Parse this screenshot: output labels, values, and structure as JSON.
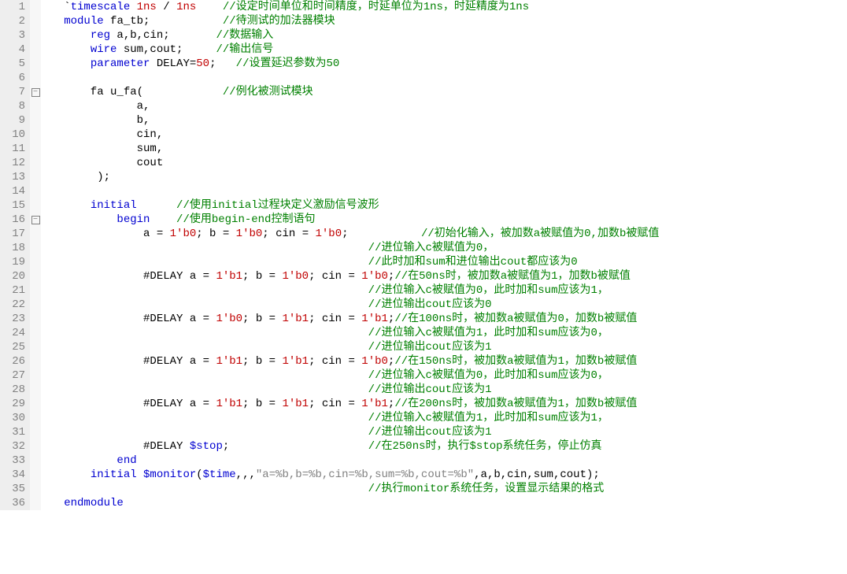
{
  "line_count": 36,
  "fold_markers": {
    "7": "⊟",
    "16": "⊟"
  },
  "lines": [
    {
      "n": 1,
      "segs": [
        {
          "t": "   `",
          "c": "tok-id"
        },
        {
          "t": "timescale ",
          "c": "tok-kw"
        },
        {
          "t": "1ns",
          "c": "tok-num"
        },
        {
          "t": " / ",
          "c": "tok-id"
        },
        {
          "t": "1ns",
          "c": "tok-num"
        },
        {
          "t": "    ",
          "c": "tok-id"
        },
        {
          "t": "//设定时间单位和时间精度，时延单位为1ns，时延精度为1ns",
          "c": "tok-cmt"
        }
      ]
    },
    {
      "n": 2,
      "segs": [
        {
          "t": "   ",
          "c": "tok-id"
        },
        {
          "t": "module",
          "c": "tok-kw"
        },
        {
          "t": " fa_tb;           ",
          "c": "tok-id"
        },
        {
          "t": "//待测试的加法器模块",
          "c": "tok-cmt"
        }
      ]
    },
    {
      "n": 3,
      "segs": [
        {
          "t": "       ",
          "c": "tok-id"
        },
        {
          "t": "reg",
          "c": "tok-kw"
        },
        {
          "t": " a,b,cin;       ",
          "c": "tok-id"
        },
        {
          "t": "//数据输入",
          "c": "tok-cmt"
        }
      ]
    },
    {
      "n": 4,
      "segs": [
        {
          "t": "       ",
          "c": "tok-id"
        },
        {
          "t": "wire",
          "c": "tok-kw"
        },
        {
          "t": " sum,cout;     ",
          "c": "tok-id"
        },
        {
          "t": "//输出信号",
          "c": "tok-cmt"
        }
      ]
    },
    {
      "n": 5,
      "segs": [
        {
          "t": "       ",
          "c": "tok-id"
        },
        {
          "t": "parameter",
          "c": "tok-kw"
        },
        {
          "t": " DELAY=",
          "c": "tok-id"
        },
        {
          "t": "50",
          "c": "tok-num"
        },
        {
          "t": ";   ",
          "c": "tok-id"
        },
        {
          "t": "//设置延迟参数为50",
          "c": "tok-cmt"
        }
      ]
    },
    {
      "n": 6,
      "segs": [
        {
          "t": "",
          "c": "tok-id"
        }
      ]
    },
    {
      "n": 7,
      "segs": [
        {
          "t": "       fa u_fa(            ",
          "c": "tok-id"
        },
        {
          "t": "//例化被测试模块",
          "c": "tok-cmt"
        }
      ]
    },
    {
      "n": 8,
      "segs": [
        {
          "t": "              a,",
          "c": "tok-id"
        }
      ]
    },
    {
      "n": 9,
      "segs": [
        {
          "t": "              b,",
          "c": "tok-id"
        }
      ]
    },
    {
      "n": 10,
      "segs": [
        {
          "t": "              cin,",
          "c": "tok-id"
        }
      ]
    },
    {
      "n": 11,
      "segs": [
        {
          "t": "              sum,",
          "c": "tok-id"
        }
      ]
    },
    {
      "n": 12,
      "segs": [
        {
          "t": "              cout",
          "c": "tok-id"
        }
      ]
    },
    {
      "n": 13,
      "segs": [
        {
          "t": "        );",
          "c": "tok-id"
        }
      ]
    },
    {
      "n": 14,
      "segs": [
        {
          "t": "",
          "c": "tok-id"
        }
      ]
    },
    {
      "n": 15,
      "segs": [
        {
          "t": "       ",
          "c": "tok-id"
        },
        {
          "t": "initial",
          "c": "tok-kw"
        },
        {
          "t": "      ",
          "c": "tok-id"
        },
        {
          "t": "//使用initial过程块定义激励信号波形",
          "c": "tok-cmt"
        }
      ]
    },
    {
      "n": 16,
      "segs": [
        {
          "t": "           ",
          "c": "tok-id"
        },
        {
          "t": "begin",
          "c": "tok-kw"
        },
        {
          "t": "    ",
          "c": "tok-id"
        },
        {
          "t": "//使用begin-end控制语句",
          "c": "tok-cmt"
        }
      ]
    },
    {
      "n": 17,
      "segs": [
        {
          "t": "               a = ",
          "c": "tok-id"
        },
        {
          "t": "1'b0",
          "c": "tok-num"
        },
        {
          "t": "; b = ",
          "c": "tok-id"
        },
        {
          "t": "1'b0",
          "c": "tok-num"
        },
        {
          "t": "; cin = ",
          "c": "tok-id"
        },
        {
          "t": "1'b0",
          "c": "tok-num"
        },
        {
          "t": ";           ",
          "c": "tok-id"
        },
        {
          "t": "//初始化输入，被加数a被赋值为0,加数b被赋值",
          "c": "tok-cmt"
        }
      ]
    },
    {
      "n": 18,
      "segs": [
        {
          "t": "                                                 ",
          "c": "tok-id"
        },
        {
          "t": "//进位输入c被赋值为0，",
          "c": "tok-cmt"
        }
      ]
    },
    {
      "n": 19,
      "segs": [
        {
          "t": "                                                 ",
          "c": "tok-id"
        },
        {
          "t": "//此时加和sum和进位输出cout都应该为0",
          "c": "tok-cmt"
        }
      ]
    },
    {
      "n": 20,
      "segs": [
        {
          "t": "               #DELAY a = ",
          "c": "tok-id"
        },
        {
          "t": "1'b1",
          "c": "tok-num"
        },
        {
          "t": "; b = ",
          "c": "tok-id"
        },
        {
          "t": "1'b0",
          "c": "tok-num"
        },
        {
          "t": "; cin = ",
          "c": "tok-id"
        },
        {
          "t": "1'b0",
          "c": "tok-num"
        },
        {
          "t": ";",
          "c": "tok-id"
        },
        {
          "t": "//在50ns时，被加数a被赋值为1，加数b被赋值",
          "c": "tok-cmt"
        }
      ]
    },
    {
      "n": 21,
      "segs": [
        {
          "t": "                                                 ",
          "c": "tok-id"
        },
        {
          "t": "//进位输入c被赋值为0，此时加和sum应该为1，",
          "c": "tok-cmt"
        }
      ]
    },
    {
      "n": 22,
      "segs": [
        {
          "t": "                                                 ",
          "c": "tok-id"
        },
        {
          "t": "//进位输出cout应该为0",
          "c": "tok-cmt"
        }
      ]
    },
    {
      "n": 23,
      "segs": [
        {
          "t": "               #DELAY a = ",
          "c": "tok-id"
        },
        {
          "t": "1'b0",
          "c": "tok-num"
        },
        {
          "t": "; b = ",
          "c": "tok-id"
        },
        {
          "t": "1'b1",
          "c": "tok-num"
        },
        {
          "t": "; cin = ",
          "c": "tok-id"
        },
        {
          "t": "1'b1",
          "c": "tok-num"
        },
        {
          "t": ";",
          "c": "tok-id"
        },
        {
          "t": "//在100ns时，被加数a被赋值为0，加数b被赋值",
          "c": "tok-cmt"
        }
      ]
    },
    {
      "n": 24,
      "segs": [
        {
          "t": "                                                 ",
          "c": "tok-id"
        },
        {
          "t": "//进位输入c被赋值为1，此时加和sum应该为0，",
          "c": "tok-cmt"
        }
      ]
    },
    {
      "n": 25,
      "segs": [
        {
          "t": "                                                 ",
          "c": "tok-id"
        },
        {
          "t": "//进位输出cout应该为1",
          "c": "tok-cmt"
        }
      ]
    },
    {
      "n": 26,
      "segs": [
        {
          "t": "               #DELAY a = ",
          "c": "tok-id"
        },
        {
          "t": "1'b1",
          "c": "tok-num"
        },
        {
          "t": "; b = ",
          "c": "tok-id"
        },
        {
          "t": "1'b1",
          "c": "tok-num"
        },
        {
          "t": "; cin = ",
          "c": "tok-id"
        },
        {
          "t": "1'b0",
          "c": "tok-num"
        },
        {
          "t": ";",
          "c": "tok-id"
        },
        {
          "t": "//在150ns时，被加数a被赋值为1，加数b被赋值",
          "c": "tok-cmt"
        }
      ]
    },
    {
      "n": 27,
      "segs": [
        {
          "t": "                                                 ",
          "c": "tok-id"
        },
        {
          "t": "//进位输入c被赋值为0，此时加和sum应该为0，",
          "c": "tok-cmt"
        }
      ]
    },
    {
      "n": 28,
      "segs": [
        {
          "t": "                                                 ",
          "c": "tok-id"
        },
        {
          "t": "//进位输出cout应该为1",
          "c": "tok-cmt"
        }
      ]
    },
    {
      "n": 29,
      "segs": [
        {
          "t": "               #DELAY a = ",
          "c": "tok-id"
        },
        {
          "t": "1'b1",
          "c": "tok-num"
        },
        {
          "t": "; b = ",
          "c": "tok-id"
        },
        {
          "t": "1'b1",
          "c": "tok-num"
        },
        {
          "t": "; cin = ",
          "c": "tok-id"
        },
        {
          "t": "1'b1",
          "c": "tok-num"
        },
        {
          "t": ";",
          "c": "tok-id"
        },
        {
          "t": "//在200ns时，被加数a被赋值为1，加数b被赋值",
          "c": "tok-cmt"
        }
      ]
    },
    {
      "n": 30,
      "segs": [
        {
          "t": "                                                 ",
          "c": "tok-id"
        },
        {
          "t": "//进位输入c被赋值为1，此时加和sum应该为1，",
          "c": "tok-cmt"
        }
      ]
    },
    {
      "n": 31,
      "segs": [
        {
          "t": "                                                 ",
          "c": "tok-id"
        },
        {
          "t": "//进位输出cout应该为1",
          "c": "tok-cmt"
        }
      ]
    },
    {
      "n": 32,
      "segs": [
        {
          "t": "               #DELAY ",
          "c": "tok-id"
        },
        {
          "t": "$stop",
          "c": "tok-kw"
        },
        {
          "t": ";                     ",
          "c": "tok-id"
        },
        {
          "t": "//在250ns时，执行$stop系统任务，停止仿真",
          "c": "tok-cmt"
        }
      ]
    },
    {
      "n": 33,
      "segs": [
        {
          "t": "           ",
          "c": "tok-id"
        },
        {
          "t": "end",
          "c": "tok-kw"
        }
      ]
    },
    {
      "n": 34,
      "segs": [
        {
          "t": "       ",
          "c": "tok-id"
        },
        {
          "t": "initial",
          "c": "tok-kw"
        },
        {
          "t": " ",
          "c": "tok-id"
        },
        {
          "t": "$monitor",
          "c": "tok-kw"
        },
        {
          "t": "(",
          "c": "tok-id"
        },
        {
          "t": "$time",
          "c": "tok-kw"
        },
        {
          "t": ",,,",
          "c": "tok-id"
        },
        {
          "t": "\"a=%b,b=%b,cin=%b,sum=%b,cout=%b\"",
          "c": "tok-str"
        },
        {
          "t": ",a,b,cin,sum,cout);",
          "c": "tok-id"
        }
      ]
    },
    {
      "n": 35,
      "segs": [
        {
          "t": "                                                 ",
          "c": "tok-id"
        },
        {
          "t": "//执行monitor系统任务，设置显示结果的格式",
          "c": "tok-cmt"
        }
      ]
    },
    {
      "n": 36,
      "segs": [
        {
          "t": "   ",
          "c": "tok-id"
        },
        {
          "t": "endmodule",
          "c": "tok-kw"
        }
      ]
    }
  ]
}
